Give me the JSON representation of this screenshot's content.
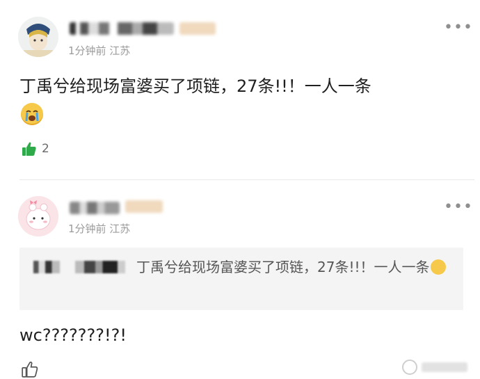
{
  "posts": [
    {
      "meta": "1分钟前 江苏",
      "content": "丁禹兮给现场富婆买了项链，27条!!！一人一条",
      "like_count": "2",
      "more_icon": "more-icon"
    },
    {
      "meta": "1分钟前 江苏",
      "quote_text": "丁禹兮给现场富婆买了项链，27条!!！一人一条",
      "reply": "wc???????!?!",
      "more_icon": "more-icon"
    }
  ],
  "colors": {
    "meta_gray": "#9b9b9b",
    "like_green": "#2eaa4b",
    "quote_bg": "#f4f4f4"
  }
}
